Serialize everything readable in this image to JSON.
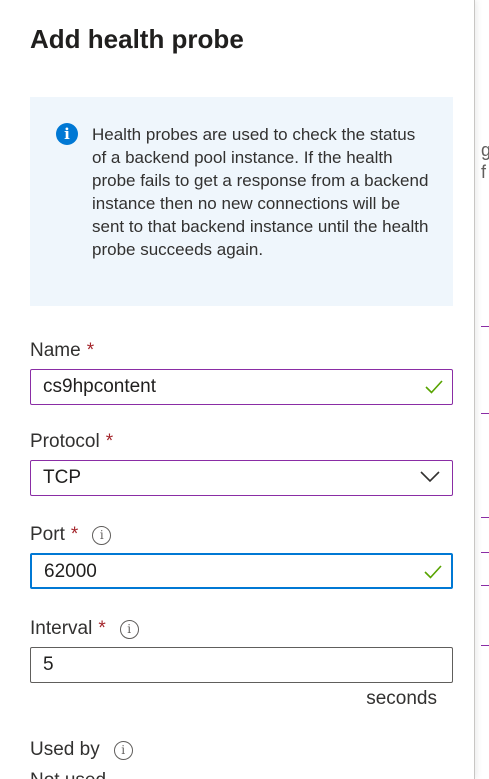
{
  "panel": {
    "title": "Add health probe"
  },
  "info": {
    "icon": "info-icon",
    "text": "Health probes are used to check the status of a backend pool instance. If the health probe fails to get a response from a backend instance then no new connections will be sent to that backend instance until the health probe succeeds again."
  },
  "fields": {
    "name": {
      "label": "Name",
      "required": "*",
      "value": "cs9hpcontent",
      "status_icon": "check-icon"
    },
    "protocol": {
      "label": "Protocol",
      "required": "*",
      "value": "TCP",
      "icon": "chevron-down-icon"
    },
    "port": {
      "label": "Port",
      "required": "*",
      "value": "62000",
      "status_icon": "check-icon"
    },
    "interval": {
      "label": "Interval",
      "required": "*",
      "value": "5",
      "unit": "seconds"
    },
    "used_by": {
      "label": "Used by",
      "value_partial": "Not used"
    }
  },
  "colors": {
    "accent_purple": "#8a2da5",
    "focus_blue": "#0078d4",
    "success_green": "#57a300",
    "required_red": "#a4262c",
    "info_bg": "#eff6fc"
  }
}
